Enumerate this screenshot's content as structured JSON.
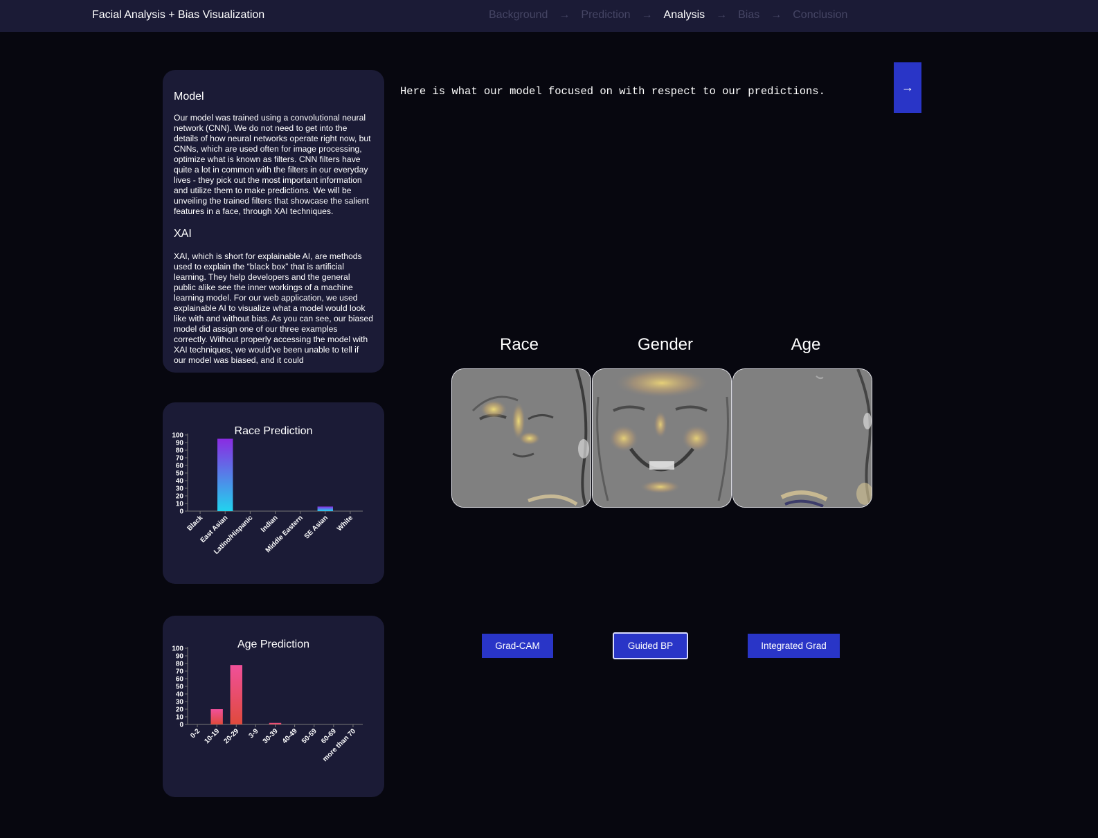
{
  "header": {
    "title": "Facial Analysis + Bias Visualization",
    "steps": [
      "Background",
      "Prediction",
      "Analysis",
      "Bias",
      "Conclusion"
    ],
    "arrow": "→",
    "active_step": "Analysis"
  },
  "info": {
    "model_heading": "Model",
    "model_text": "Our model was trained using a convolutional neural network (CNN). We do not need to get into the details of how neural networks operate right now, but CNNs, which are used often for image processing, optimize what is known as filters. CNN filters have quite a lot in common with the filters in our everyday lives - they pick out the most important information and utilize them to make predictions. We will be unveiling the trained filters that showcase the salient features in a face, through XAI techniques.",
    "xai_heading": "XAI",
    "xai_text": "XAI, which is short for explainable AI, are methods used to explain the “black box” that is artificial learning. They help developers and the general public alike see the inner workings of a machine learning model. For our web application, we used explainable AI to visualize what a model would look like with and without bias. As you can see, our biased model did assign one of our three examples correctly. Without properly accessing the model with XAI techniques, we would've been unable to tell if our model was biased, and it could"
  },
  "main": {
    "intro": "Here is what our model focused on with respect to our predictions.",
    "next_label": "→",
    "columns": [
      "Race",
      "Gender",
      "Age"
    ],
    "methods": [
      "Grad-CAM",
      "Guided BP",
      "Integrated Grad"
    ],
    "selected_method": "Guided BP"
  },
  "colors": {
    "race_bar_top": "#8a2be2",
    "race_bar_bottom": "#22d3ee",
    "age_bar_top": "#f0509a",
    "age_bar_bottom": "#e04a3c",
    "accent": "#2935c7",
    "card_bg": "#1b1b36"
  },
  "chart_data": [
    {
      "type": "bar",
      "title": "Race Prediction",
      "categories": [
        "Black",
        "East Asian",
        "Latino/Hispanic",
        "Indian",
        "Middle Eastern",
        "SE Asian",
        "White"
      ],
      "values": [
        0,
        95,
        0,
        0,
        0,
        6,
        0
      ],
      "ylim": [
        0,
        100
      ],
      "yticks": [
        0,
        10,
        20,
        30,
        40,
        50,
        60,
        70,
        80,
        90,
        100
      ],
      "xlabel": "",
      "ylabel": ""
    },
    {
      "type": "bar",
      "title": "Age Prediction",
      "categories": [
        "0-2",
        "10-19",
        "20-29",
        "3-9",
        "30-39",
        "40-49",
        "50-59",
        "60-69",
        "more than 70"
      ],
      "values": [
        0,
        20,
        78,
        0,
        2,
        0,
        0,
        0,
        0
      ],
      "ylim": [
        0,
        100
      ],
      "yticks": [
        0,
        10,
        20,
        30,
        40,
        50,
        60,
        70,
        80,
        90,
        100
      ],
      "xlabel": "",
      "ylabel": ""
    }
  ]
}
